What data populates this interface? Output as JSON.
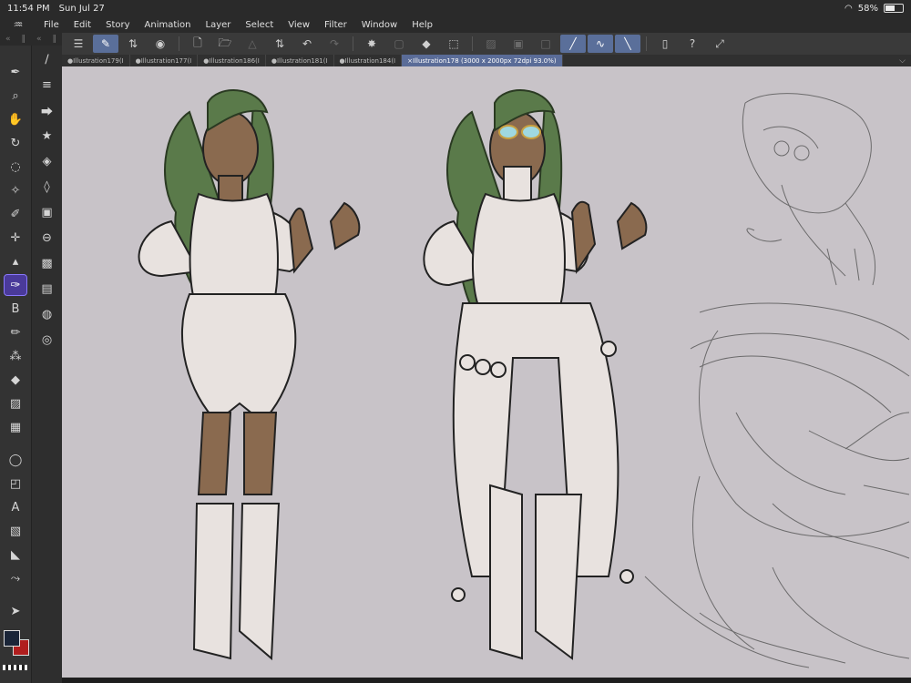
{
  "status": {
    "time": "11:54 PM",
    "date": "Sun Jul 27",
    "battery": "58%",
    "battery_level": 0.58
  },
  "menu": [
    "File",
    "Edit",
    "Story",
    "Animation",
    "Layer",
    "Select",
    "View",
    "Filter",
    "Window",
    "Help"
  ],
  "tabs": [
    {
      "label": "Illustration179(I",
      "active": false
    },
    {
      "label": "Illustration177(I",
      "active": false
    },
    {
      "label": "Illustration186(I",
      "active": false
    },
    {
      "label": "Illustration181(I",
      "active": false
    },
    {
      "label": "Illustration184(I",
      "active": false
    },
    {
      "label": "Illustration178 (3000 x 2000px 72dpi 93.0%)",
      "active": true
    }
  ],
  "colors": {
    "main": "#1a2538",
    "sub": "#b01e1e",
    "canvas": "#c8c3c8",
    "accent": "#5a6c98"
  },
  "tools_left": [
    "pen-nib-icon",
    "zoom-icon",
    "hand-icon",
    "rotate-icon",
    "lasso-icon",
    "magic-wand-icon",
    "eyedropper-icon",
    "move-icon",
    "fill-tool-icon",
    "pen-icon",
    "blend-icon",
    "pencil-icon",
    "airbrush-icon",
    "bucket-icon",
    "eraser-icon",
    "frame-icon",
    "circle-icon",
    "ruler-icon",
    "text-icon",
    "gradient-icon",
    "shape-icon",
    "correction-icon",
    "select-object-icon"
  ],
  "tools_right": [
    "brush-size-icon",
    "tool-property-icon",
    "navigator-icon",
    "material-icon",
    "layer-icon",
    "layer-property-icon",
    "sub-view-icon",
    "search-icon",
    "color-wheel-icon",
    "color-slider-icon",
    "color-set-icon",
    "history-icon"
  ],
  "selected_tool": "pen-icon"
}
